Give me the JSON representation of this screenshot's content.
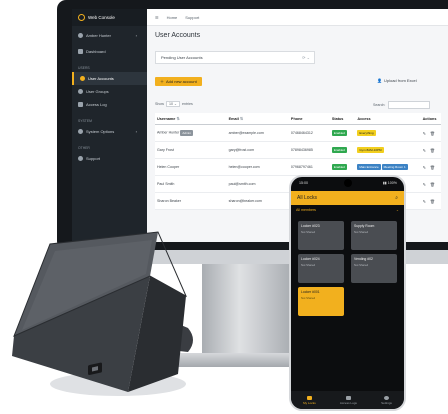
{
  "sidebar": {
    "brand": "Web Console",
    "user": "Amber Hunter",
    "items": [
      {
        "label": "Dashboard",
        "icon": "dashboard-icon"
      },
      {
        "section": "USERS"
      },
      {
        "label": "User Accounts",
        "icon": "users-icon",
        "active": true
      },
      {
        "label": "User Groups",
        "icon": "groups-icon"
      },
      {
        "label": "Access Log",
        "icon": "log-icon"
      },
      {
        "section": "SYSTEM"
      },
      {
        "label": "System Options",
        "icon": "gear-icon"
      },
      {
        "section": "OTHER"
      },
      {
        "label": "Support",
        "icon": "support-icon"
      }
    ]
  },
  "topbar": {
    "home": "Home",
    "support": "Support"
  },
  "page": {
    "title": "User Accounts",
    "pending": "Pending User Accounts",
    "add_button": "Add new account",
    "upload_link": "Upload from Excel",
    "show": "Show",
    "entries_count": "10",
    "entries": "entries",
    "search_label": "Search:"
  },
  "table": {
    "headers": [
      "Username",
      "Email",
      "Phone",
      "Status",
      "Access",
      "Actions"
    ],
    "rows": [
      {
        "username": "Amber Hunter",
        "tag": "Admin",
        "email": "amber@example.com",
        "phone": "07468464312",
        "status": "Enabled",
        "access": [
          {
            "label": "Everything",
            "color": "yellow"
          }
        ]
      },
      {
        "username": "Gary Frost",
        "email": "gary@frost.com",
        "phone": "07898436985",
        "status": "Enabled",
        "access": [
          {
            "label": "Gym 8AM-10PM",
            "color": "yellow"
          }
        ]
      },
      {
        "username": "Helen Cooper",
        "email": "helen@cooper.com",
        "phone": "07968797461",
        "status": "Enabled",
        "access": [
          {
            "label": "Main Entrance",
            "color": "blue"
          },
          {
            "label": "Meeting Room 1",
            "color": "blue"
          }
        ]
      },
      {
        "username": "Paul Smith",
        "email": "paul@smith.com",
        "phone": "07903652043",
        "status": "Enabled",
        "access": []
      },
      {
        "username": "Sharon Beaker",
        "email": "sharon@beaker.com",
        "phone": "07982023945",
        "status": "Enabled",
        "access": []
      }
    ]
  },
  "phone": {
    "time": "15:00",
    "battery": "100%",
    "app_title": "All Locks",
    "filter": "All members",
    "locks": [
      {
        "name": "Locker #023",
        "sub": "Not Shared"
      },
      {
        "name": "Supply Room",
        "sub": "Not Shared"
      },
      {
        "name": "Locker #024",
        "sub": "Not Shared"
      },
      {
        "name": "Vending #02",
        "sub": "Not Shared"
      },
      {
        "name": "Locker #001",
        "sub": "Not Shared",
        "open": true
      }
    ],
    "nav": [
      "My Locks",
      "Access Logs",
      "Settings"
    ]
  },
  "colors": {
    "accent": "#f2b01e",
    "sidebar": "#1f252b",
    "enabled": "#2fa84f",
    "phone_bg": "#0c0d0f"
  }
}
